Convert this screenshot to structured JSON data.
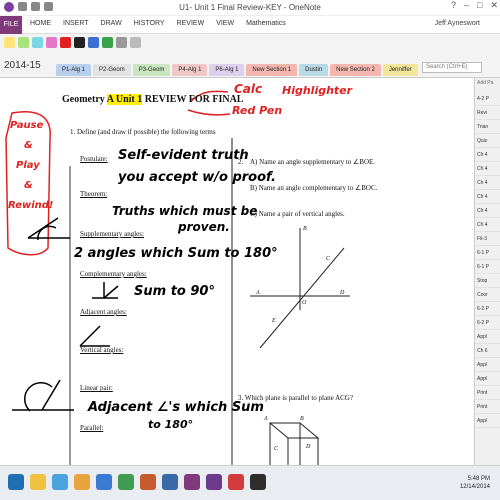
{
  "window": {
    "title": "U1- Unit 1 Final Review-KEY - OneNote",
    "controls": [
      "?",
      "–",
      "□",
      "✕"
    ]
  },
  "ribbon": {
    "file": "FILE",
    "tabs": [
      "HOME",
      "INSERT",
      "DRAW",
      "HISTORY",
      "REVIEW",
      "VIEW",
      "Mathematics"
    ],
    "user": "Jeff Ayneswort"
  },
  "notebook": {
    "name": "2014-15"
  },
  "section_tabs": [
    {
      "label": "P1-Alg 1",
      "color": "#b9cfee"
    },
    {
      "label": "P2-Geom",
      "color": "#e3e3e3"
    },
    {
      "label": "P3-Geom",
      "color": "#c9e6c0"
    },
    {
      "label": "P4-Alg 1",
      "color": "#f0c8c8"
    },
    {
      "label": "P6-Alg 1",
      "color": "#dcd1ec"
    },
    {
      "label": "New Section 1",
      "color": "#f4b7b0"
    },
    {
      "label": "Dustin",
      "color": "#b8d9e6"
    },
    {
      "label": "New Section 2",
      "color": "#f4b7b0"
    },
    {
      "label": "Jenniffer",
      "color": "#f3e59b"
    }
  ],
  "search": {
    "placeholder": "Search (Ctrl+E)"
  },
  "page": {
    "title_prefix": "Geometry ",
    "title_highlight": "A Unit 1",
    "title_suffix": " REVIEW FOR FINAL",
    "q1": "1.   Define (and draw if possible) the following terms",
    "terms": {
      "postulate": "Postulate:",
      "theorem": "Theorem:",
      "supplementary": "Supplementary angles:",
      "complementary": "Complementary angles:",
      "adjacent": "Adjacent angles:",
      "vertical": "Vertical angles:",
      "linear_pair": "Linear pair:",
      "parallel": "Parallel:"
    },
    "q2": "2.",
    "q2a": "A) Name an angle supplementary to ∠BOE.",
    "q2b": "B) Name an angle complementary to ∠BOC.",
    "q2c": "C) Name a pair of vertical angles.",
    "diagram_labels": {
      "B": "B",
      "C": "C",
      "A": "A",
      "D": "D",
      "O": "O",
      "E": "E"
    },
    "q3": "3.   Which plane is parallel to plane ACG?",
    "prism_labels": {
      "A": "A",
      "B": "B",
      "C": "C",
      "D": "D"
    }
  },
  "ink": {
    "calc": "Calc",
    "highlighter": "Highlighter",
    "red_pen": "Red Pen",
    "pause1": "Pause",
    "amp1": "&",
    "play": "Play",
    "amp2": "&",
    "rewind": "Rewind!",
    "postulate_def1": "Self-evident truth",
    "postulate_def2": "you accept w/o proof.",
    "theorem_def1": "Truths which must be",
    "theorem_def2": "proven.",
    "supp_def": "2 angles which Sum to 180°",
    "comp_def": "Sum to 90°",
    "linear_def1": "Adjacent ∠'s which Sum",
    "linear_def2": "to 180°"
  },
  "right_pane": {
    "add_page": "Add Pa",
    "pages": [
      "4-2 P",
      "Revi",
      "Trian",
      "Quiz",
      "Ch 4",
      "Ch 4",
      "Ch 4",
      "Ch 4",
      "Ch 4",
      "Ch 4",
      "Fit-3",
      "6-1 P",
      "6-1 P",
      "Stop",
      "Coor",
      "6-2 P",
      "6-2 P",
      "Appl",
      "Ch 6",
      "Appl",
      "Appl",
      "Print",
      "Print",
      "Appl"
    ]
  },
  "taskbar": {
    "time": "5:48 PM",
    "date": "12/14/2014"
  },
  "colors": {
    "onenote_purple": "#80397b",
    "ink_red": "#e02020",
    "highlight": "#ffef00"
  }
}
